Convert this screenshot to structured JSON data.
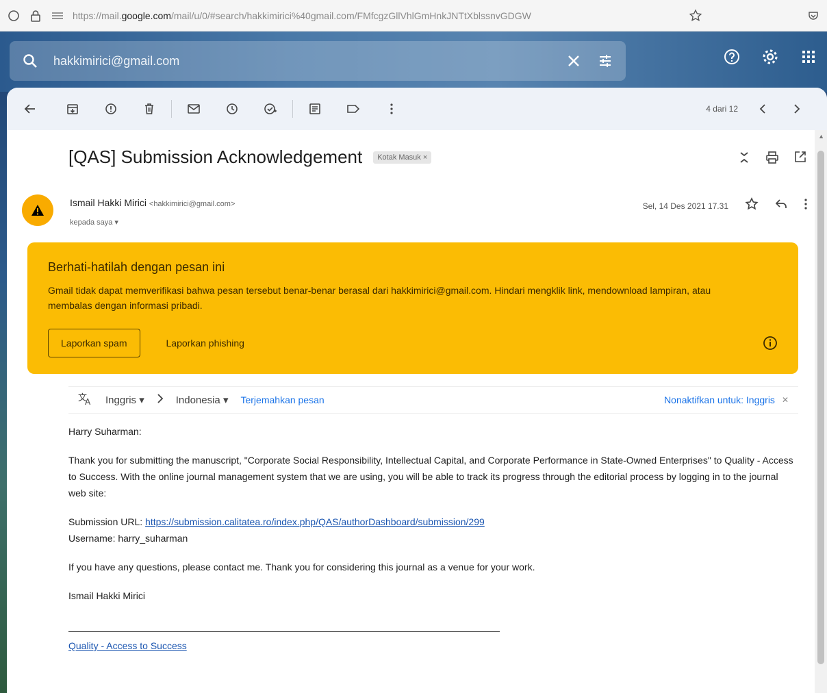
{
  "browser": {
    "url_prefix": "https://mail.",
    "url_host": "google.com",
    "url_rest": "/mail/u/0/#search/hakkimirici%40gmail.com/FMfcgzGllVhlGmHnkJNTtXblssnvGDGW"
  },
  "header": {
    "search_query": "hakkimirici@gmail.com"
  },
  "toolbar": {
    "pager_text": "4 dari 12"
  },
  "message": {
    "subject": "[QAS] Submission Acknowledgement",
    "label_chip": "Kotak Masuk ×",
    "sender_name": "Ismail Hakki Mirici",
    "sender_email": "<hakkimirici@gmail.com>",
    "to_me": "kepada saya ▾",
    "date": "Sel, 14 Des 2021 17.31"
  },
  "warning": {
    "title": "Berhati-hatilah dengan pesan ini",
    "body": "Gmail tidak dapat memverifikasi bahwa pesan tersebut benar-benar berasal dari hakkimirici@gmail.com. Hindari mengklik link, mendownload lampiran, atau membalas dengan informasi pribadi.",
    "report_spam": "Laporkan spam",
    "report_phishing": "Laporkan phishing"
  },
  "translate": {
    "from_lang": "Inggris ▾",
    "to_lang": "Indonesia ▾",
    "translate_link": "Terjemahkan pesan",
    "disable_link": "Nonaktifkan untuk: Inggris"
  },
  "body": {
    "greeting": "Harry Suharman:",
    "para1": "Thank you for submitting the manuscript, \"Corporate Social Responsibility, Intellectual Capital, and Corporate Performance in State-Owned Enterprises\" to Quality - Access to Success. With the online journal management system that we are using, you will be able to track its progress through the editorial process by logging in to the journal web site:",
    "url_label": "Submission URL: ",
    "url": "https://submission.calitatea.ro/index.php/QAS/authorDashboard/submission/299",
    "username_line": "Username: harry_suharman",
    "para2": "If you have any questions, please contact me. Thank you for considering this journal as a venue for your work.",
    "signature": "Ismail Hakki Mirici",
    "footer_link": "Quality - Access to Success"
  },
  "colors": {
    "warning_bg": "#fbbc04",
    "avatar_bg": "#f9ab00",
    "link": "#1a73e8"
  }
}
